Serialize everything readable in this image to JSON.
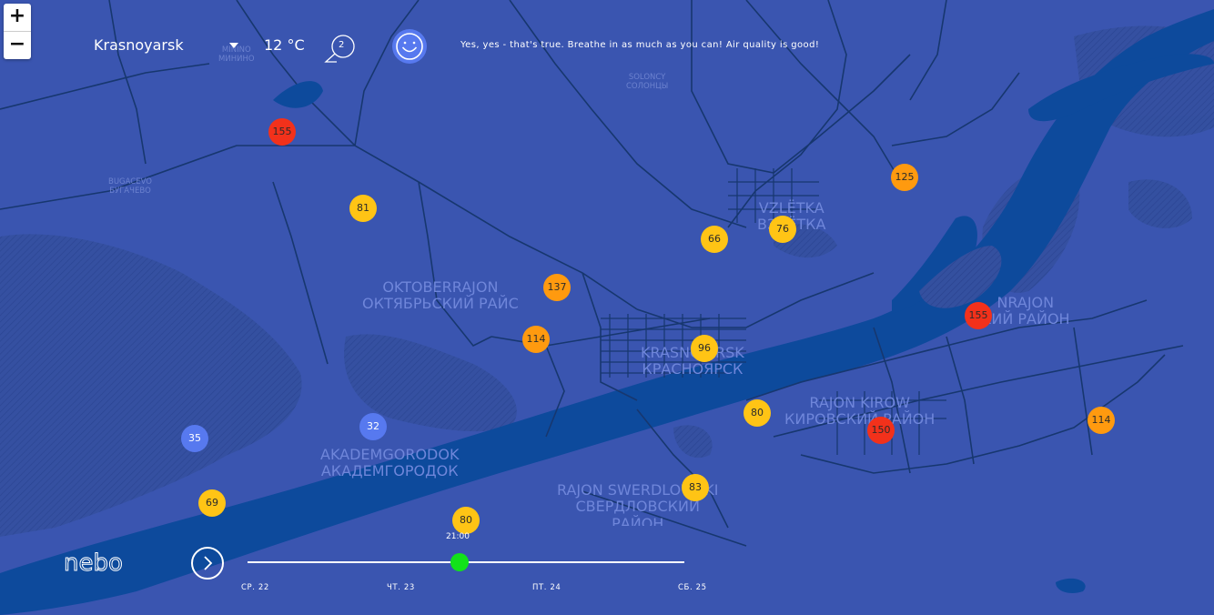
{
  "zoom": {
    "in_label": "+",
    "out_label": "−"
  },
  "header": {
    "city": "Krasnoyarsk",
    "temperature": "12 °C",
    "comment_count": "2",
    "status_icon": "smiley-face-icon",
    "message": "Yes, yes - that's true. Breathe in as much as you can! Air quality is good!"
  },
  "colors": {
    "map_background": "#3a55b0",
    "water": "#0d4a9c",
    "roads": "#17376f",
    "aqi_red": "#f2311b",
    "aqi_orange": "#ff9a0f",
    "aqi_yellow": "#ffc415",
    "aqi_blue": "#5779ef",
    "timeline_knob": "#12e21a"
  },
  "places": {
    "oktober_lat": "OKTOBERRAJON",
    "oktober_cyr": "ОКТЯБРЬСКИЙ РАЙС",
    "vzletka_lat": "VZLЁTKA",
    "vzletka_cyr": "ВЗЛЁТКА",
    "center_lat": "KRASNOJARSK",
    "center_cyr": "КРАСНОЯРСК",
    "east_lat": "NRAJON",
    "east_cyr": "КИЙ РАЙОН",
    "kirow_lat": "RAJON KIROW",
    "kirow_cyr": "КИРОВСКИЙ РАЙОН",
    "akadem_lat": "AKADEMGORODOK",
    "akadem_cyr": "АКАДЕМГОРОДОК",
    "swerd_lat": "RAJON SWERDLOWSKI",
    "swerd_cyr": "СВЕРДЛОВСКИЙ",
    "swerd_cyr2": "РАЙОН",
    "solncy_lat": "SOLONCY",
    "solncy_cyr": "СОЛОНЦЫ",
    "bugach_lat": "BUGACEVO",
    "bugach_cyr": "БУГАЧЕВО",
    "minino_lat": "MININO",
    "minino_cyr": "МИНИНО"
  },
  "stations": [
    {
      "value": "155",
      "level": "red"
    },
    {
      "value": "81",
      "level": "yellow"
    },
    {
      "value": "125",
      "level": "orange"
    },
    {
      "value": "66",
      "level": "yellow"
    },
    {
      "value": "76",
      "level": "yellow"
    },
    {
      "value": "137",
      "level": "orange"
    },
    {
      "value": "114",
      "level": "orange"
    },
    {
      "value": "96",
      "level": "yellow"
    },
    {
      "value": "155",
      "level": "red"
    },
    {
      "value": "80",
      "level": "yellow"
    },
    {
      "value": "150",
      "level": "red"
    },
    {
      "value": "114",
      "level": "orange"
    },
    {
      "value": "35",
      "level": "blue"
    },
    {
      "value": "32",
      "level": "blue"
    },
    {
      "value": "83",
      "level": "yellow"
    },
    {
      "value": "69",
      "level": "yellow"
    },
    {
      "value": "80",
      "level": "yellow"
    }
  ],
  "timeline": {
    "logo": "nebo",
    "current_time": "21:00",
    "days": [
      "СР. 22",
      "ЧТ. 23",
      "ПТ. 24",
      "СБ. 25"
    ]
  }
}
